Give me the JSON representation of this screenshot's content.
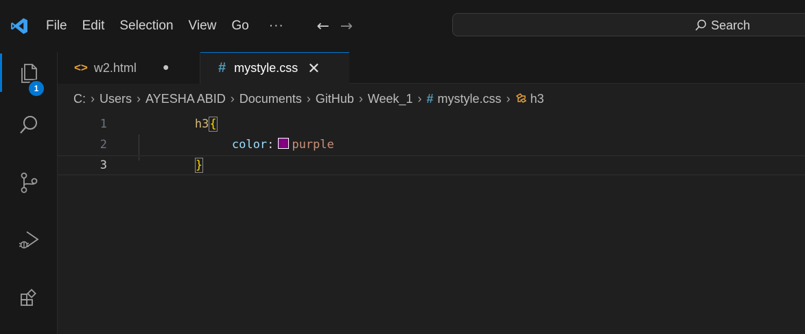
{
  "titlebar": {
    "menu": [
      "File",
      "Edit",
      "Selection",
      "View",
      "Go",
      "···"
    ],
    "search_placeholder": "Search"
  },
  "activitybar": {
    "explorer_badge": "1"
  },
  "tabs": [
    {
      "label": "w2.html",
      "icon": "html-file-icon",
      "modified": true
    },
    {
      "label": "mystyle.css",
      "icon": "css-file-icon",
      "active": true
    }
  ],
  "breadcrumbs": {
    "parts": [
      "C:",
      "Users",
      "AYESHA ABID",
      "Documents",
      "GitHub",
      "Week_1"
    ],
    "file": "mystyle.css",
    "symbol": "h3"
  },
  "editor": {
    "line_numbers": [
      "1",
      "2",
      "3"
    ],
    "selector": "h3",
    "open_brace": "{",
    "property": "color",
    "colon": ":",
    "value": "purple",
    "swatch_color": "#800080",
    "close_brace": "}"
  },
  "colors": {
    "accent": "#0078d4",
    "background": "#1f1f1f",
    "chrome": "#181818"
  }
}
